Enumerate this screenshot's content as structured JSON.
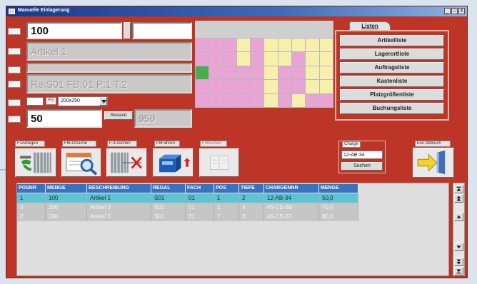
{
  "window": {
    "title": "Manuelle Einlagerung",
    "minimize": "_",
    "maximize": "□",
    "close": "X",
    "icon": "app-icon"
  },
  "form": {
    "pl_value": "100",
    "pl_extra_value": "",
    "article_value": "Artikel 1",
    "article_extra_value": "",
    "location_value": "Re:S01 FB:01 P:1 T:2",
    "small_value": "",
    "fg_label": "FG",
    "size_value": "200x250",
    "quantity_value": "50",
    "rest_button": "Restand",
    "rest_value": "950"
  },
  "slot_grid": {
    "rows": [
      "PPPYPYYYYY",
      "PPPYPYYPYY",
      "GPPPPYPPYY",
      "PPPPPYPPYY",
      "PPPPPYPYPP"
    ],
    "status_colors": {
      "P": "#e8a4d4",
      "Y": "#f7efac",
      "G": "#49ad4c"
    }
  },
  "lists": {
    "tab": "Listen",
    "buttons": [
      "Artikelliste",
      "Lagerortliste",
      "Auftragsliste",
      "Kastenliste",
      "Platzgrößenliste",
      "Buchungsliste"
    ]
  },
  "toolbar": [
    {
      "label": "F1Anlegen",
      "icon": "create-storage-icon"
    },
    {
      "label": "F6LOSuche",
      "icon": "search-form-icon"
    },
    {
      "label": "F7Löschen",
      "icon": "delete-storage-icon"
    },
    {
      "label": "F8Fahren",
      "icon": "drive-machine-icon"
    },
    {
      "label": "F9Buchen",
      "icon": "book-icon",
      "disabled": true
    }
  ],
  "charge": {
    "label": "Charge",
    "value": "12-AB-34",
    "button": "Suchen"
  },
  "cancel": {
    "label": "Esc Abbruch",
    "icon": "exit-door-icon"
  },
  "table": {
    "columns": [
      "POSNR",
      "MENGE",
      "BESCHREIBUNG",
      "REGAL",
      "FACH",
      "POS",
      "TIEFE",
      "CHARGENNR",
      "MENGE"
    ],
    "rows": [
      [
        "1",
        "100",
        "Artikel 1",
        "S01",
        "01",
        "1",
        "2",
        "12-AB-34",
        "50,0"
      ],
      [
        "3",
        "200",
        "Artikel 2",
        "S01",
        "01",
        "1",
        "4",
        "45-CD-89",
        "70,0"
      ],
      [
        "2",
        "200",
        "Artikel 2",
        "S01",
        "01",
        "7",
        "2",
        "45-CD-67",
        "80,0"
      ]
    ],
    "selected_row": 0
  },
  "scrollbar": {
    "buttons": [
      "scroll-top-icon",
      "page-up-icon",
      "scroll-up-icon",
      "scroll-down-icon",
      "page-down-icon",
      "scroll-bottom-icon"
    ]
  },
  "colors": {
    "window_bg": "#bd3526",
    "titlebar": "#17398a",
    "table_header": "#3b72bf",
    "selected_row": "#5ec3d2",
    "row_bg": "#c6c6c6"
  }
}
